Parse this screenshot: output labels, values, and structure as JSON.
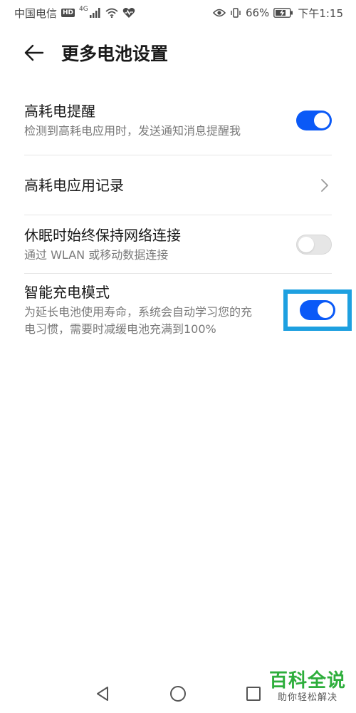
{
  "status_bar": {
    "carrier": "中国电信",
    "hd": "HD",
    "network_type": "4G",
    "battery_percent": "66%",
    "time": "下午1:15"
  },
  "header": {
    "title": "更多电池设置"
  },
  "settings": [
    {
      "title": "高耗电提醒",
      "description": "检测到高耗电应用时，发送通知消息提醒我",
      "control": "toggle",
      "enabled": true
    },
    {
      "title": "高耗电应用记录",
      "control": "chevron"
    },
    {
      "title": "休眠时始终保持网络连接",
      "description": "通过 WLAN 或移动数据连接",
      "control": "toggle",
      "enabled": false
    },
    {
      "title": "智能充电模式",
      "description": "为延长电池使用寿命，系统会自动学习您的充电习惯，需要时减缓电池充满到100%",
      "control": "toggle",
      "enabled": true
    }
  ],
  "watermark": {
    "title": "百科全说",
    "subtitle": "助你轻松解决"
  },
  "colors": {
    "accent": "#0a59f7",
    "highlight": "#1ea0e0",
    "watermark": "#2eae3c"
  },
  "icons": {
    "back": "arrow-left-icon",
    "chevron": "chevron-right-icon",
    "nav_back": "triangle-back-icon",
    "nav_home": "circle-home-icon",
    "nav_recents": "square-recents-icon"
  }
}
